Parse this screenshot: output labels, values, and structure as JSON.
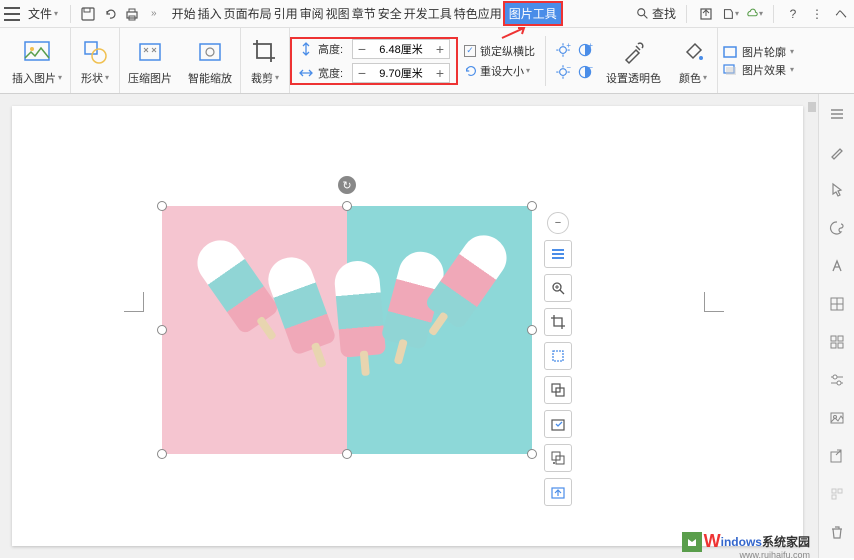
{
  "menu": {
    "file": "文件"
  },
  "tabs": {
    "start": "开始",
    "insert": "插入",
    "layout": "页面布局",
    "ref": "引用",
    "review": "审阅",
    "view": "视图",
    "section": "章节",
    "security": "安全",
    "dev": "开发工具",
    "special": "特色应用",
    "pictools": "图片工具"
  },
  "search": {
    "label": "查找"
  },
  "ribbon": {
    "insert_pic": "插入图片",
    "shape": "形状",
    "compress": "压缩图片",
    "smartzoom": "智能缩放",
    "crop": "裁剪",
    "height_label": "高度:",
    "height_val": "6.48厘米",
    "width_label": "宽度:",
    "width_val": "9.70厘米",
    "lock_ratio": "锁定纵横比",
    "reset_size": "重设大小",
    "set_transparent": "设置透明色",
    "color": "颜色",
    "pic_outline": "图片轮廓",
    "pic_effects": "图片效果"
  },
  "float": {
    "minus": "−",
    "plus": "+"
  },
  "watermark": {
    "brand": "indows",
    "suffix": "系统家园",
    "url": "www.ruihaifu.com"
  }
}
